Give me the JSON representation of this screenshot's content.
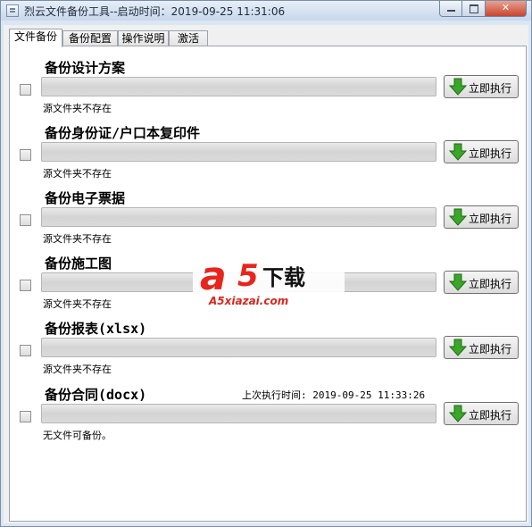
{
  "window": {
    "title": "烈云文件备份工具--启动时间：2019-09-25 11:31:06"
  },
  "tabs": [
    {
      "label": "文件备份",
      "active": true
    },
    {
      "label": "备份配置",
      "active": false
    },
    {
      "label": "操作说明",
      "active": false
    },
    {
      "label": "激活",
      "active": false
    }
  ],
  "tasks": [
    {
      "title": "备份设计方案",
      "status": "源文件夹不存在",
      "button": "立即执行",
      "checked": false
    },
    {
      "title": "备份身份证/户口本复印件",
      "status": "源文件夹不存在",
      "button": "立即执行",
      "checked": false
    },
    {
      "title": "备份电子票据",
      "status": "源文件夹不存在",
      "button": "立即执行",
      "checked": false
    },
    {
      "title": "备份施工图",
      "status": "源文件夹不存在",
      "button": "立即执行",
      "checked": false
    },
    {
      "title": "备份报表(xlsx)",
      "status": "源文件夹不存在",
      "button": "立即执行",
      "checked": false
    },
    {
      "title": "备份合同(docx)",
      "status": "无文件可备份。",
      "button": "立即执行",
      "checked": false,
      "last_run": "上次执行时间: 2019-09-25 11:33:26"
    }
  ],
  "watermark": {
    "logo_a": "a",
    "logo_5": "5",
    "logo_text": "下载",
    "domain": "A5xiazai.com"
  },
  "colors": {
    "accent_green": "#3aa62a",
    "watermark_red": "#e8241c"
  }
}
